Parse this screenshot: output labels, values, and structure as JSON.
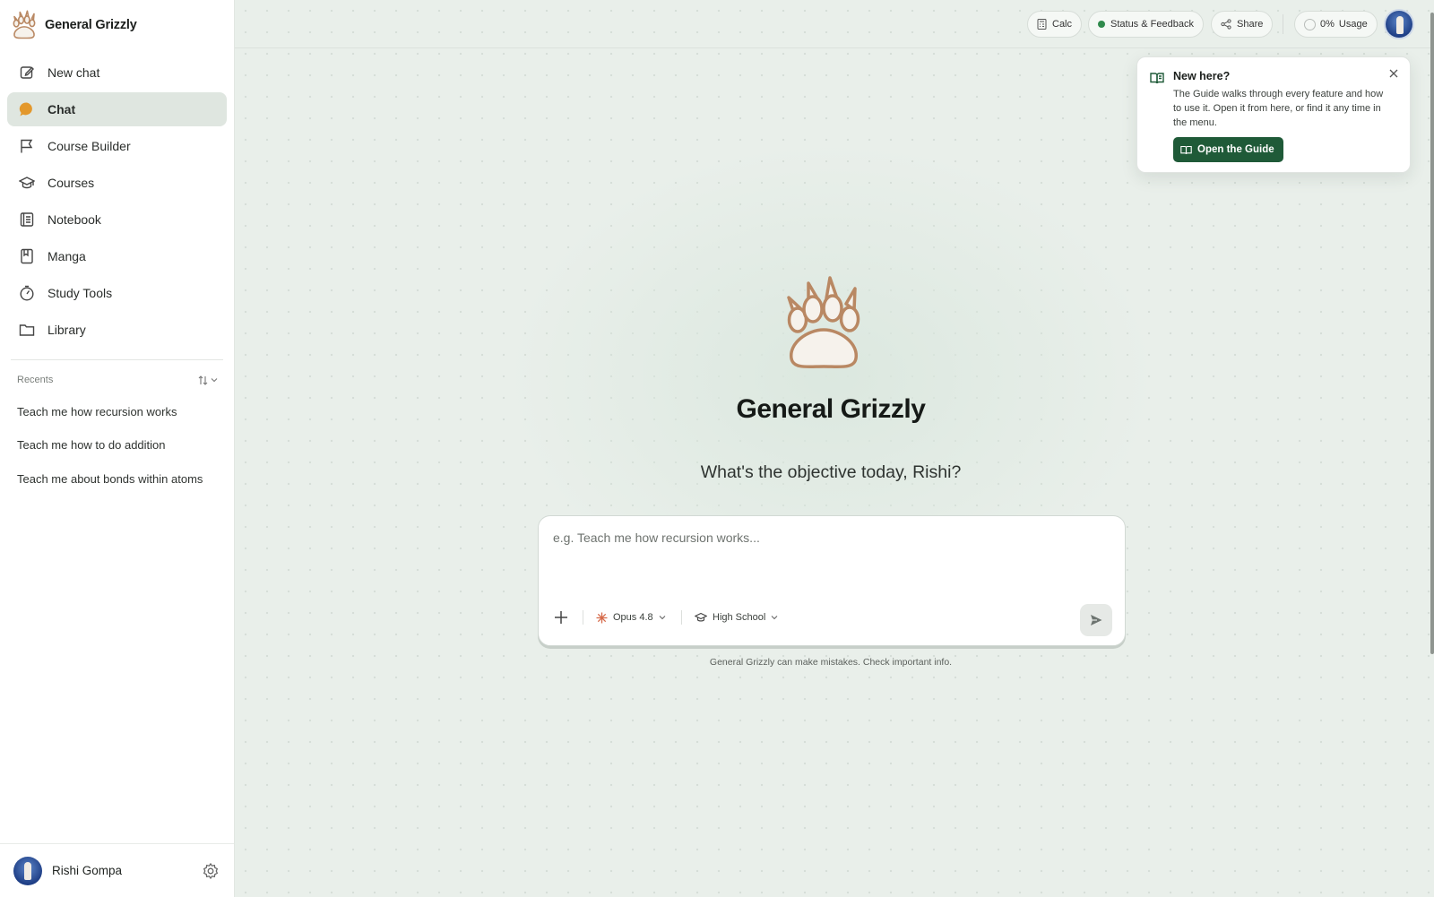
{
  "brand": {
    "name": "General Grizzly"
  },
  "sidebar": {
    "nav": [
      {
        "label": "New chat",
        "icon": "edit-icon",
        "active": false
      },
      {
        "label": "Chat",
        "icon": "chat-bubble-icon",
        "active": true
      },
      {
        "label": "Course Builder",
        "icon": "flag-icon",
        "active": false
      },
      {
        "label": "Courses",
        "icon": "graduation-cap-icon",
        "active": false
      },
      {
        "label": "Notebook",
        "icon": "notebook-icon",
        "active": false
      },
      {
        "label": "Manga",
        "icon": "book-icon",
        "active": false
      },
      {
        "label": "Study Tools",
        "icon": "timer-icon",
        "active": false
      },
      {
        "label": "Library",
        "icon": "folder-icon",
        "active": false
      }
    ],
    "recents_label": "Recents",
    "recents": [
      "Teach me how recursion works",
      "Teach me how to do addition",
      "Teach me about bonds within atoms"
    ],
    "user_name": "Rishi Gompa"
  },
  "topbar": {
    "calc": "Calc",
    "status": "Status & Feedback",
    "share": "Share",
    "usage_percent": "0%",
    "usage_label": "Usage"
  },
  "guide": {
    "title": "New here?",
    "body": "The Guide walks through every feature and how to use it. Open it from here, or find it any time in the menu.",
    "button": "Open the Guide"
  },
  "hero": {
    "title": "General Grizzly",
    "subtitle": "What's the objective today, Rishi?"
  },
  "composer": {
    "placeholder": "e.g. Teach me how recursion works...",
    "model": "Opus 4.8",
    "level": "High School"
  },
  "disclaimer": "General Grizzly can make mistakes. Check important info.",
  "colors": {
    "accent_green": "#1f5a38",
    "chat_orange": "#e3982c",
    "paw_brown": "#b98863",
    "status_green": "#2f8a4c"
  }
}
